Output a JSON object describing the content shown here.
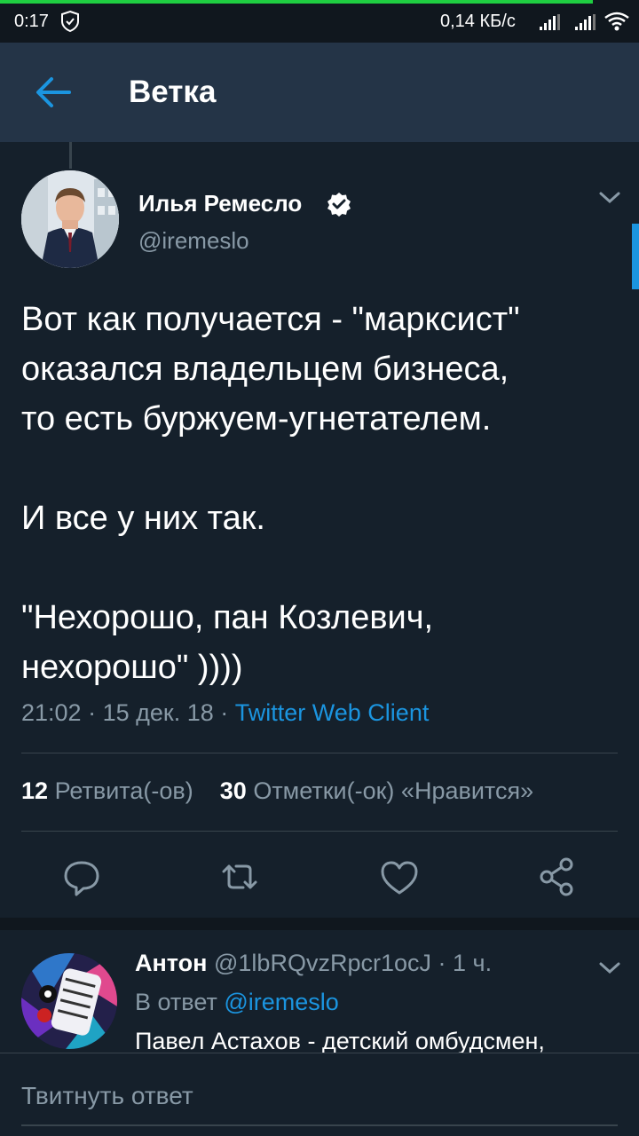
{
  "status_bar": {
    "time": "0:17",
    "network_speed": "0,14 КБ/с",
    "icons": [
      "shield-icon",
      "signal-icon",
      "signal-icon",
      "wifi-icon"
    ]
  },
  "app_bar": {
    "title": "Ветка",
    "back_icon": "arrow-left-icon"
  },
  "main_tweet": {
    "author": {
      "name": "Илья Ремесло",
      "handle": "@iremeslo",
      "verified": true
    },
    "text_paragraphs": [
      "Вот как получается - \"марксист\"\nоказался владельцем бизнеса,\nто есть буржуем-угнетателем.",
      "И все у них так.",
      "\"Нехорошо, пан Козлевич,\nнехорошо\" ))))"
    ],
    "time": "21:02",
    "date": "15 дек. 18",
    "client": "Twitter Web Client",
    "retweets_count": "12",
    "retweets_label": "Ретвита(-ов)",
    "likes_count": "30",
    "likes_label": "Отметки(-ок) «Нравится»",
    "actions": [
      "reply-icon",
      "retweet-icon",
      "like-icon",
      "share-icon"
    ]
  },
  "reply": {
    "name": "Антон",
    "handle": "@1lbRQvzRpcr1ocJ",
    "age": "1 ч.",
    "reply_prefix": "В ответ",
    "reply_to": "@iremeslo",
    "text": "Павел Астахов - детский омбудсмен,"
  },
  "compose": {
    "placeholder": "Твитнуть ответ"
  },
  "colors": {
    "background": "#15202b",
    "app_bar": "#243447",
    "accent": "#1b95e0",
    "secondary_text": "#8899a6",
    "status_green": "#1fce41"
  }
}
